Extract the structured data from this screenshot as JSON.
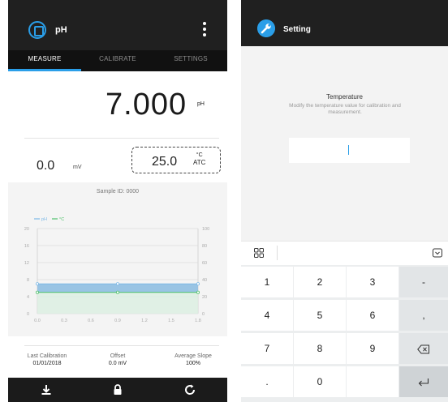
{
  "left": {
    "app_title": "pH",
    "tabs": [
      {
        "label": "MEASURE",
        "active": true
      },
      {
        "label": "CALIBRATE",
        "active": false
      },
      {
        "label": "SETTINGS",
        "active": false
      }
    ],
    "ph_value": "7.000",
    "ph_unit": "pH",
    "mv_value": "0.0",
    "mv_unit": "mV",
    "temperature_value": "25.0",
    "temperature_unit": "°C",
    "temperature_mode": "ATC",
    "sample_id": "Sample ID: 0000",
    "stats": {
      "last_calibration_label": "Last Calibration",
      "last_calibration_value": "01/01/2018",
      "offset_label": "Offset",
      "offset_value": "0.0 mV",
      "slope_label": "Average Slope",
      "slope_value": "100%"
    },
    "bottom_icons": [
      "save-icon",
      "lock-icon",
      "refresh-icon"
    ],
    "accent_color": "#2a9ee8"
  },
  "right": {
    "title": "Setting",
    "dialog_title": "Temperature",
    "dialog_description": "Modify the temperature value for calibration and measurement.",
    "input_value": "",
    "keyboard_rows": [
      [
        "1",
        "2",
        "3",
        "-"
      ],
      [
        "4",
        "5",
        "6",
        ","
      ],
      [
        "7",
        "8",
        "9",
        "backspace"
      ],
      [
        ".",
        "0",
        "",
        "enter"
      ]
    ]
  },
  "chart_data": {
    "type": "line",
    "legend": [
      "pH",
      "°C"
    ],
    "x_ticks": [
      "0.0",
      "0.3",
      "0.6",
      "0.9",
      "1.2",
      "1.5",
      "1.8"
    ],
    "y_left_ticks": [
      "0",
      "4",
      "8",
      "12",
      "16",
      "20"
    ],
    "y_right_ticks": [
      "0",
      "20",
      "40",
      "60",
      "80",
      "100"
    ],
    "xlim": [
      0,
      1.8
    ],
    "ylim_left": [
      0,
      20
    ],
    "ylim_right": [
      0,
      100
    ],
    "series": [
      {
        "name": "pH",
        "axis": "left",
        "color": "#7cb8e6",
        "x": [
          0,
          0.9,
          1.8
        ],
        "y": [
          7,
          7,
          7
        ]
      },
      {
        "name": "°C",
        "axis": "right",
        "color": "#4ec06a",
        "x": [
          0,
          0.9,
          1.8
        ],
        "y": [
          25,
          25,
          25
        ]
      }
    ]
  }
}
